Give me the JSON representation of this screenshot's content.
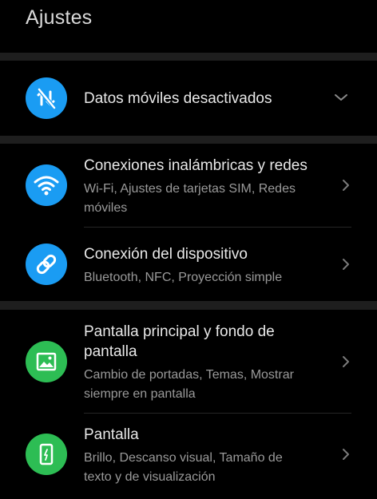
{
  "header": {
    "title": "Ajustes"
  },
  "mobile_data": {
    "label": "Datos móviles desactivados",
    "icon": "mobile-data-off-icon"
  },
  "items": [
    {
      "label": "Conexiones inalámbricas y redes",
      "sub_line1": "Wi-Fi, Ajustes de tarjetas SIM, Redes",
      "sub_line2": "móviles",
      "icon": "wifi-icon"
    },
    {
      "label": "Conexión del dispositivo",
      "sub_line1": "Bluetooth, NFC, Proyección simple",
      "icon": "link-icon"
    },
    {
      "label_line1": "Pantalla principal y fondo de",
      "label_line2": "pantalla",
      "sub_line1": "Cambio de portadas, Temas, Mostrar",
      "sub_line2": "siempre en pantalla",
      "icon": "image-icon"
    },
    {
      "label": "Pantalla",
      "sub_line1": "Brillo, Descanso visual, Tamaño de",
      "sub_line2": "texto y de visualización",
      "icon": "phone-screen-icon"
    }
  ],
  "colors": {
    "blue": "#1a9cf3",
    "green": "#2dbd54",
    "background": "#000000",
    "divider": "#1e1e1e"
  }
}
